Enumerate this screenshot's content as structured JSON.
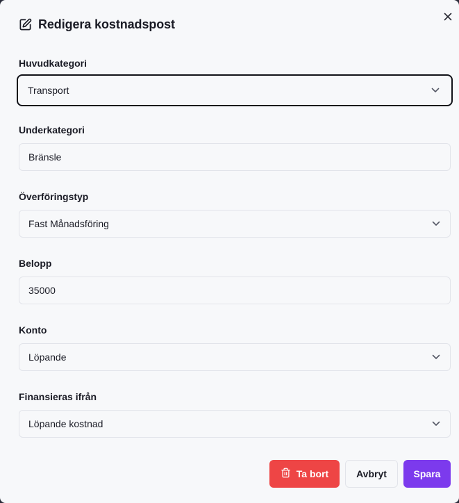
{
  "dialog": {
    "title": "Redigera kostnadspost",
    "icons": {
      "title_icon": "edit-icon",
      "close_icon": "close-icon"
    }
  },
  "fields": {
    "main_category": {
      "label": "Huvudkategori",
      "value": "Transport"
    },
    "sub_category": {
      "label": "Underkategori",
      "value": "Bränsle"
    },
    "transfer_type": {
      "label": "Överföringstyp",
      "value": "Fast Månadsföring"
    },
    "amount": {
      "label": "Belopp",
      "value": "35000"
    },
    "account": {
      "label": "Konto",
      "value": "Löpande"
    },
    "funded_from": {
      "label": "Finansieras ifrån",
      "value": "Löpande kostnad"
    }
  },
  "buttons": {
    "delete": "Ta bort",
    "cancel": "Avbryt",
    "save": "Spara"
  },
  "colors": {
    "delete": "#ee4545",
    "save": "#7c3aed",
    "background": "#f7f8fa"
  }
}
